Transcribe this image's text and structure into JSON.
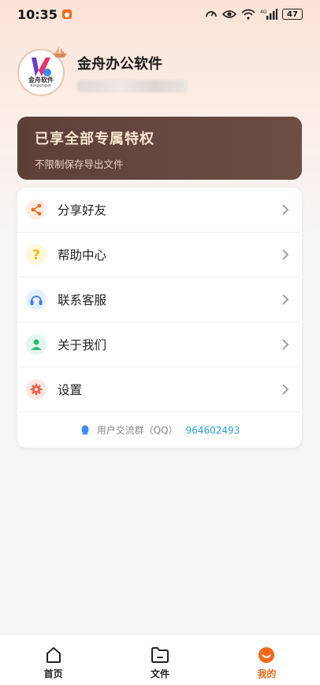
{
  "status_bar": {
    "time": "10:35",
    "battery": "47"
  },
  "profile": {
    "app_name": "金舟办公软件",
    "avatar_name": "金舟软件",
    "avatar_sub": "Kingshiper"
  },
  "vip": {
    "title": "已享全部专属特权",
    "subtitle": "不限制保存导出文件"
  },
  "menu": {
    "items": [
      {
        "label": "分享好友",
        "icon": "share-icon",
        "color": "#f26a1b"
      },
      {
        "label": "帮助中心",
        "icon": "help-icon",
        "color": "#f5b50b"
      },
      {
        "label": "联系客服",
        "icon": "headset-icon",
        "color": "#3d7cf2"
      },
      {
        "label": "关于我们",
        "icon": "user-icon",
        "color": "#2dbb7c"
      },
      {
        "label": "设置",
        "icon": "gear-icon",
        "color": "#f0614a"
      }
    ],
    "qq_label": "用户交流群（QQ）",
    "qq_number": "964602493"
  },
  "tabbar": {
    "tabs": [
      {
        "label": "首页",
        "icon": "home-icon"
      },
      {
        "label": "文件",
        "icon": "folder-icon"
      },
      {
        "label": "我的",
        "icon": "smile-icon",
        "active": true
      }
    ],
    "active_color": "#f26a1b"
  }
}
